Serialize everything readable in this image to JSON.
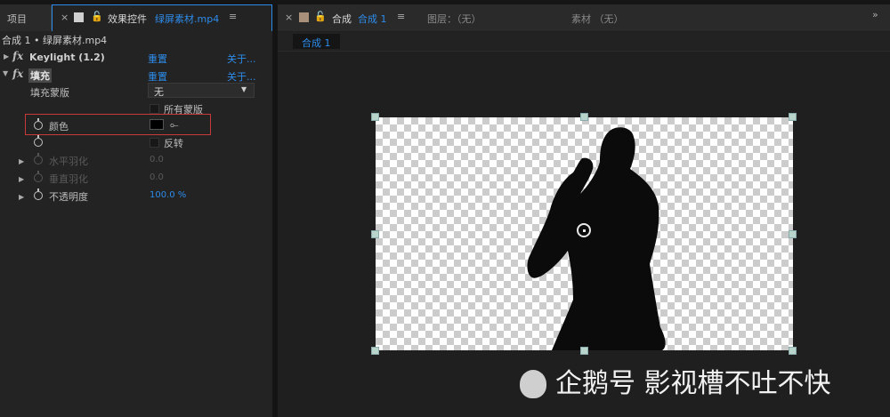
{
  "left_panel": {
    "tab_project": "项目",
    "tab_effect": "效果控件",
    "tab_effect_file": "绿屏素材.mp4",
    "breadcrumb": "合成 1 • 绿屏素材.mp4",
    "effects": [
      {
        "name": "Keylight (1.2)",
        "reset": "重置",
        "about": "关于..."
      },
      {
        "name": "填充",
        "reset": "重置",
        "about": "关于..."
      }
    ],
    "fill_mask_label": "填充蒙版",
    "fill_mask_value": "无",
    "all_masks_label": "所有蒙版",
    "color_label": "颜色",
    "invert_label": "反转",
    "h_feather_label": "水平羽化",
    "h_feather_value": "0.0",
    "v_feather_label": "垂直羽化",
    "v_feather_value": "0.0",
    "opacity_label": "不透明度",
    "opacity_value": "100.0 %",
    "fill_color": "#000000"
  },
  "right_panel": {
    "tab_comp": "合成",
    "tab_comp_name": "合成 1",
    "layer_label": "图层：（无）",
    "footage_label": "素材 （无）",
    "subtab": "合成 1"
  },
  "watermark": "企鹅号 影视槽不吐不快",
  "colors": {
    "accent": "#2d8ceb",
    "highlight_box": "#c83a3a",
    "handle": "#b9d5cb"
  }
}
